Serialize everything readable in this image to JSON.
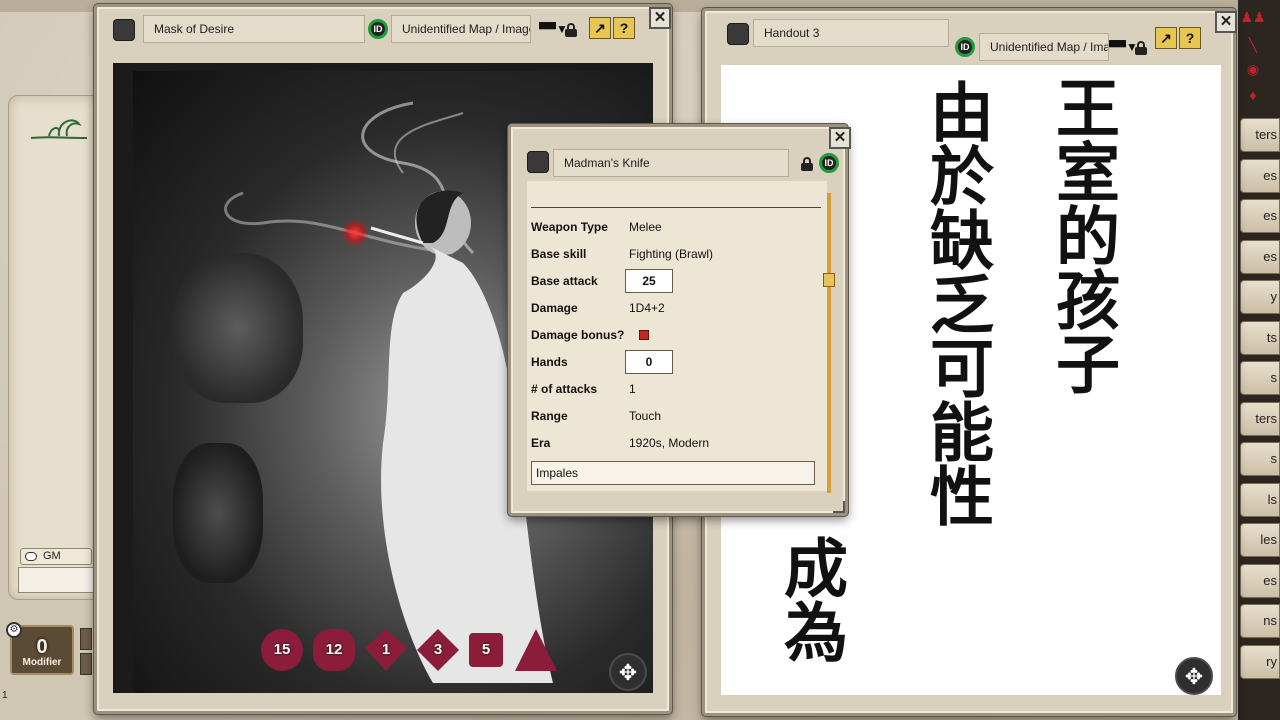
{
  "windows": {
    "image_handout": {
      "tab_title": "Mask of Desire",
      "tab_type": "Unidentified Map / Image",
      "id_badge": "ID"
    },
    "text_handout": {
      "tab_title": "Handout 3",
      "tab_type": "Unidentified Map / Image",
      "id_badge": "ID",
      "calligraphy_columns": [
        "王室的孩子",
        "由於缺乏可能性",
        "成為"
      ]
    },
    "weapon_record": {
      "title": "Madman's Knife",
      "id_badge": "ID",
      "fields": [
        {
          "label": "Weapon Type",
          "value": "Melee"
        },
        {
          "label": "Base skill",
          "value": "Fighting (Brawl)"
        },
        {
          "label": "Base attack",
          "value": "25"
        },
        {
          "label": "Damage",
          "value": "1D4+2"
        },
        {
          "label": "Damage bonus?",
          "value": ""
        },
        {
          "label": "Hands",
          "value": "0"
        },
        {
          "label": "# of attacks",
          "value": "1"
        },
        {
          "label": "Range",
          "value": "Touch"
        },
        {
          "label": "Era",
          "value": "1920s, Modern"
        }
      ],
      "notes": "Impales",
      "damage_bonus_checked": true
    }
  },
  "buttons": {
    "popout": "↗",
    "help": "?",
    "close": "✕",
    "move": "✥"
  },
  "dice": [
    "20",
    "12",
    "10",
    "8",
    "6",
    "4"
  ],
  "dice_faces": [
    "15",
    "12",
    "1",
    "3",
    "5",
    ""
  ],
  "chat": {
    "speaker": "GM"
  },
  "modifier": {
    "value": "0",
    "label": "Modifier"
  },
  "bottom_counter": "1",
  "sidebar_labels": [
    "ters",
    "es",
    "es",
    "es",
    "y",
    "ts",
    "s",
    "ters",
    "s",
    "ls",
    "les",
    "es",
    "ns",
    "ry"
  ],
  "colors": {
    "dice": "#8b1d3b",
    "id_ring": "#1f9d3a",
    "accent_gold": "#e8c652",
    "scrollbar": "#d89e3a"
  }
}
